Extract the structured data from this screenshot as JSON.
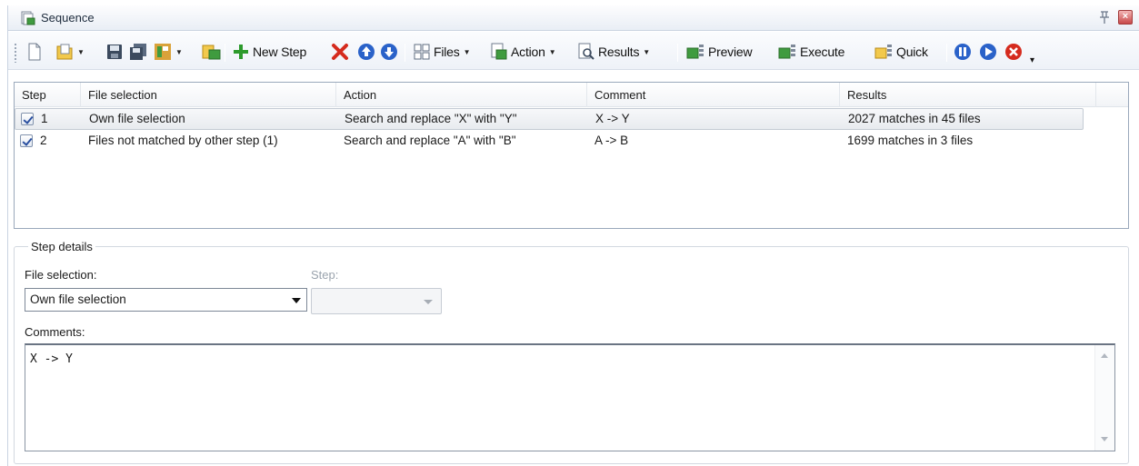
{
  "window": {
    "title": "Sequence"
  },
  "toolbar": {
    "new_step_label": "New Step",
    "files_label": "Files",
    "action_label": "Action",
    "results_label": "Results",
    "preview_label": "Preview",
    "execute_label": "Execute",
    "quick_label": "Quick",
    "accent_green": "#2c9a2c",
    "accent_red": "#d52b1e",
    "accent_blue": "#2a62c9"
  },
  "grid": {
    "columns": [
      "Step",
      "File selection",
      "Action",
      "Comment",
      "Results"
    ],
    "rows": [
      {
        "checked": true,
        "step": "1",
        "file_selection": "Own file selection",
        "action": "Search and replace \"X\" with \"Y\"",
        "comment": "X -> Y",
        "results": "2027 matches in 45 files",
        "selected": true
      },
      {
        "checked": true,
        "step": "2",
        "file_selection": "Files not matched by other step (1)",
        "action": "Search and replace \"A\" with \"B\"",
        "comment": "A -> B",
        "results": "1699 matches in 3 files",
        "selected": false
      }
    ]
  },
  "details": {
    "legend": "Step details",
    "file_selection_label": "File selection:",
    "file_selection_value": "Own file selection",
    "step_label": "Step:",
    "step_value": "",
    "comments_label": "Comments:",
    "comments_value": "X -> Y"
  }
}
